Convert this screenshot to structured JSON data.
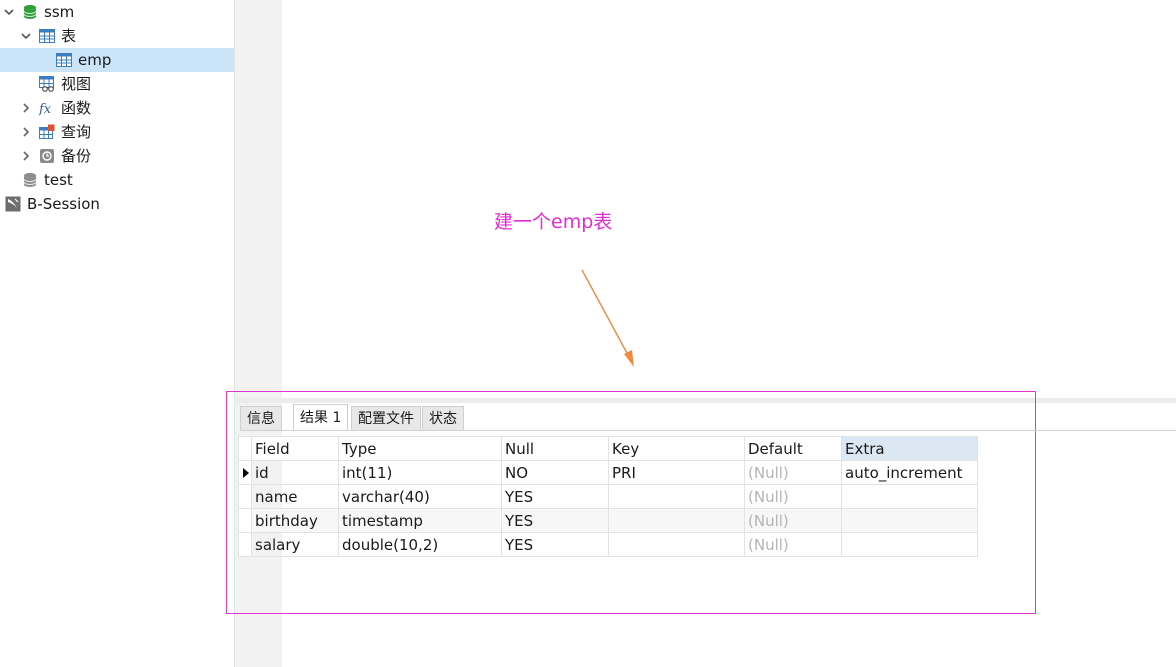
{
  "tree": {
    "nodes": [
      {
        "label": "ssm",
        "icon": "database-icon",
        "expanded": true
      },
      {
        "label": "表",
        "icon": "table-icon",
        "expanded": true
      },
      {
        "label": "emp",
        "icon": "table-icon",
        "selected": true
      },
      {
        "label": "视图",
        "icon": "view-icon"
      },
      {
        "label": "函数",
        "icon": "function-icon",
        "expanded": false
      },
      {
        "label": "查询",
        "icon": "query-icon",
        "expanded": false
      },
      {
        "label": "备份",
        "icon": "backup-icon",
        "expanded": false
      },
      {
        "label": "test",
        "icon": "database-icon"
      },
      {
        "label": "B-Session",
        "icon": "connection-icon"
      }
    ]
  },
  "annotation": {
    "text": "建一个emp表",
    "color": "#e62bd6",
    "arrow_color": "#f08a3c"
  },
  "result": {
    "tabs": [
      "信息",
      "结果 1",
      "配置文件",
      "状态"
    ],
    "active_tab": "结果 1",
    "columns": [
      "Field",
      "Type",
      "Null",
      "Key",
      "Default",
      "Extra"
    ],
    "rows": [
      [
        "id",
        "int(11)",
        "NO",
        "PRI",
        "(Null)",
        "auto_increment"
      ],
      [
        "name",
        "varchar(40)",
        "YES",
        "",
        "(Null)",
        ""
      ],
      [
        "birthday",
        "timestamp",
        "YES",
        "",
        "(Null)",
        ""
      ],
      [
        "salary",
        "double(10,2)",
        "YES",
        "",
        "(Null)",
        ""
      ]
    ]
  },
  "colors": {
    "selection": "#cce4f7",
    "sorted_header": "#dbe7f3",
    "null_text": "#b4b4b4"
  }
}
